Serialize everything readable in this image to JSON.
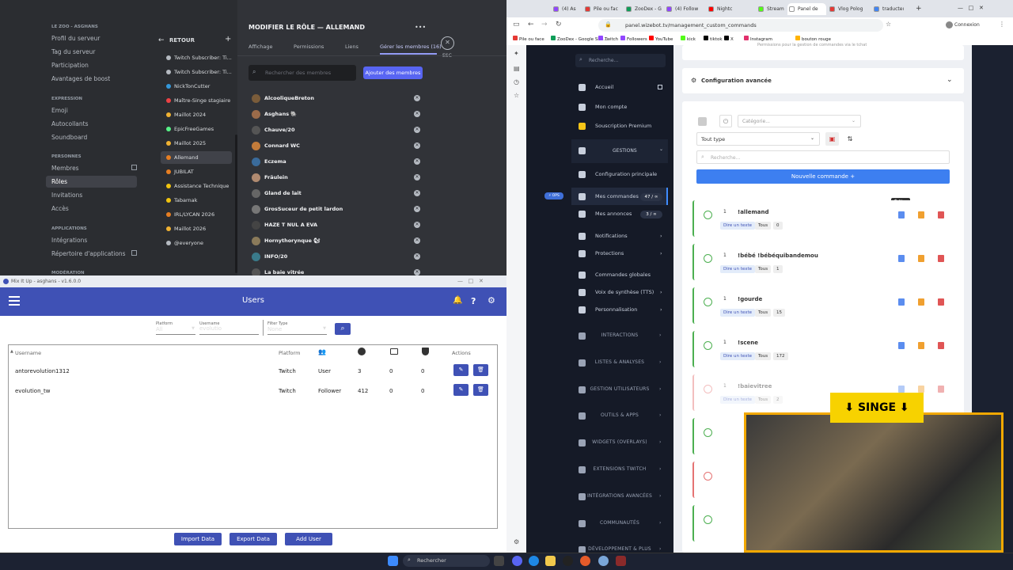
{
  "discord": {
    "server_header": "LE ZOO - ASGHANS",
    "nav_top": [
      "Profil du serveur",
      "Tag du serveur",
      "Participation",
      "Avantages de boost"
    ],
    "section_expression": "EXPRESSION",
    "nav_expression": [
      "Emoji",
      "Autocollants",
      "Soundboard"
    ],
    "section_personnes": "PERSONNES",
    "nav_personnes": [
      "Membres",
      "Rôles",
      "Invitations",
      "Accès"
    ],
    "section_applications": "APPLICATIONS",
    "nav_applications": [
      "Intégrations",
      "Répertoire d'applications"
    ],
    "section_moderation": "MODÉRATION",
    "back_label": "RETOUR",
    "add_label": "+",
    "roles": [
      {
        "name": "Twitch Subscriber: Ti...",
        "color": "#b5bac1"
      },
      {
        "name": "Twitch Subscriber: Ti...",
        "color": "#b5bac1"
      },
      {
        "name": "NickTonCutter",
        "color": "#3498db"
      },
      {
        "name": "Maître-Singe stagiaire",
        "color": "#ed4245"
      },
      {
        "name": "Maillot 2024",
        "color": "#f0b232"
      },
      {
        "name": "EpicFreeGames",
        "color": "#57f287"
      },
      {
        "name": "Maillot 2025",
        "color": "#f0b232"
      },
      {
        "name": "Allemand",
        "color": "#e67e22"
      },
      {
        "name": "JUBILAT",
        "color": "#e67e22"
      },
      {
        "name": "Assistance Technique",
        "color": "#f1c40f"
      },
      {
        "name": "Tabarnak",
        "color": "#f1c40f"
      },
      {
        "name": "IRL/LYCAN 2026",
        "color": "#e67e22"
      },
      {
        "name": "Maillot 2026",
        "color": "#f0b232"
      },
      {
        "name": "@everyone",
        "color": "#b5bac1"
      }
    ],
    "role_title": "MODIFIER LE RÔLE — ALLEMAND",
    "more_label": "•••",
    "tabs": [
      "Affichage",
      "Permissions",
      "Liens",
      "Gérer les membres (16)"
    ],
    "esc_label": "ESC",
    "close_label": "✕",
    "search_placeholder": "Rechercher des membres",
    "add_members_label": "Ajouter des membres",
    "members": [
      "AlcooliqueBreton",
      "Asghans 🐘",
      "Chauve/20",
      "Connard WC",
      "Eczema",
      "Fräulein",
      "Gland de lait",
      "GrosSuceur de petit lardon",
      "HAZE T NUL A EVA",
      "Hornythorynque 🐿",
      "INFO/20",
      "La baie vitrée"
    ]
  },
  "mixitup": {
    "window_title": "Mix It Up - asghans - v1.6.0.0",
    "page_title": "Users",
    "filter_platform_label": "Platform",
    "filter_platform_value": "All",
    "filter_username_label": "Username",
    "filter_username_value": "evolutio",
    "filter_type_label": "Filter Type",
    "filter_type_value": "None",
    "headers": [
      "Username",
      "Platform",
      "Actions"
    ],
    "rows": [
      {
        "username": "antorevolution1312",
        "platform": "Twitch",
        "type": "User",
        "v1": "3",
        "v2": "0",
        "v3": "0"
      },
      {
        "username": "evolution_tw",
        "platform": "Twitch",
        "type": "Follower",
        "v1": "412",
        "v2": "0",
        "v3": "0"
      }
    ],
    "btn_import": "Import Data",
    "btn_export": "Export Data",
    "btn_add": "Add User"
  },
  "browser": {
    "tabs": [
      "(4) As",
      "Pile ou fac",
      "ZooDex - G",
      "(4) Follow",
      "Nightc",
      "Stream",
      "Panel de",
      "Vlog Polog",
      "traducteur"
    ],
    "active_tab": "Panel de",
    "new_tab": "+",
    "url": "panel.wizebot.tv/management_custom_commands",
    "account_label": "Connexion",
    "bookmarks": [
      "Pile ou face",
      "ZooDex - Google She...",
      "Twitch",
      "Followers",
      "YouTube",
      "kick",
      "tiktok",
      "X",
      "Instagram",
      "bouton rouge"
    ]
  },
  "wizebot": {
    "search_placeholder": "Recherche...",
    "nav": [
      "Accueil",
      "Mon compte",
      "Souscription Premium"
    ],
    "gestions_label": "GESTIONS",
    "gestions_items": [
      "Configuration principale",
      "Mes commandes",
      "Mes annonces",
      "Notifications",
      "Protections",
      "Commandes globales",
      "Voix de synthèse (TTS)",
      "Personnalisation"
    ],
    "cmd_count": "47 / ∞",
    "annonce_count": "3 / ∞",
    "badge_label": "⚡ OPS",
    "categories": [
      "INTERACTIONS",
      "LISTES & ANALYSES",
      "GESTION UTILISATEURS",
      "OUTILS & APPS",
      "WIDGETS (OVERLAYS)",
      "EXTENSIONS TWITCH",
      "INTÉGRATIONS AVANCÉES",
      "COMMUNAUTÉS",
      "DÉVELOPPEMENT & PLUS"
    ],
    "top_note": "Permissions pour la gestion de commandes via le tchat",
    "config_title": "Configuration avancée",
    "category_placeholder": "Catégorie...",
    "type_value": "Tout type",
    "cmd_search_placeholder": "Recherche...",
    "new_command_label": "Nouvelle commande  +",
    "tooltip": "Éditer",
    "commands": [
      {
        "name": "!allemand",
        "uses": "0",
        "enabled": true
      },
      {
        "name": "!bébé !bébéquibandemou",
        "uses": "1",
        "enabled": true
      },
      {
        "name": "!gourde",
        "uses": "15",
        "enabled": true
      },
      {
        "name": "!scene",
        "uses": "172",
        "enabled": true
      },
      {
        "name": "!baievitree",
        "uses": "2",
        "enabled": false
      }
    ],
    "tag_say": "Dire un texte",
    "tag_all": "Tous",
    "cmd_index": "1"
  },
  "overlay": {
    "singe_label": "⬇ SINGE ⬇"
  },
  "taskbar": {
    "search_placeholder": "Rechercher"
  }
}
